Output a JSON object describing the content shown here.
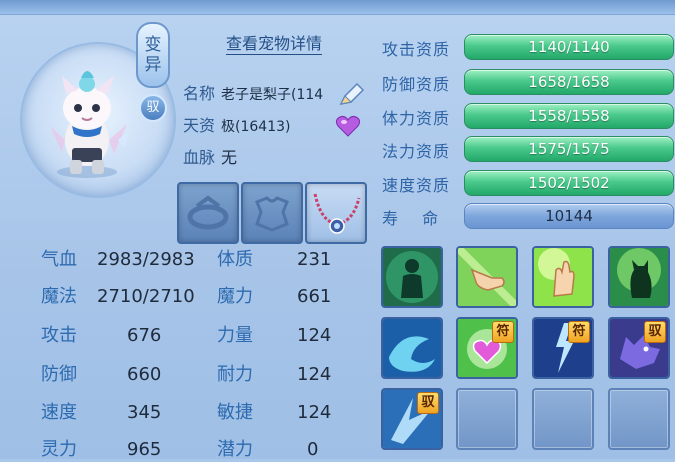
{
  "pet": {
    "badge_change": "变异",
    "badge_tame": "驭",
    "detail_link": "查看宠物详情",
    "name_label": "名称",
    "name_value": "老子是梨子(114",
    "talent_label": "天资",
    "talent_value": "极(16413)",
    "blood_label": "血脉",
    "blood_value": "无"
  },
  "stats_left": [
    {
      "label": "气血",
      "value": "2983/2983"
    },
    {
      "label": "魔法",
      "value": "2710/2710"
    },
    {
      "label": "攻击",
      "value": "676"
    },
    {
      "label": "防御",
      "value": "660"
    },
    {
      "label": "速度",
      "value": "345"
    },
    {
      "label": "灵力",
      "value": "965"
    }
  ],
  "stats_right": [
    {
      "label": "体质",
      "value": "231"
    },
    {
      "label": "魔力",
      "value": "661"
    },
    {
      "label": "力量",
      "value": "124"
    },
    {
      "label": "耐力",
      "value": "124"
    },
    {
      "label": "敏捷",
      "value": "124"
    },
    {
      "label": "潜力",
      "value": "0"
    }
  ],
  "aptitudes": [
    {
      "label": "攻击资质",
      "value": "1140/1140"
    },
    {
      "label": "防御资质",
      "value": "1658/1658"
    },
    {
      "label": "体力资质",
      "value": "1558/1558"
    },
    {
      "label": "法力资质",
      "value": "1575/1575"
    },
    {
      "label": "速度资质",
      "value": "1502/1502"
    },
    {
      "label": "寿　 命",
      "value": "10144"
    }
  ],
  "skill_tags": {
    "fu1": "符",
    "fu2": "符",
    "yu1": "驭",
    "yu2": "驭"
  },
  "colors": {
    "accent_green": "#22a86a",
    "label_blue": "#2d6bb0",
    "panel": "#a7c4e8"
  }
}
